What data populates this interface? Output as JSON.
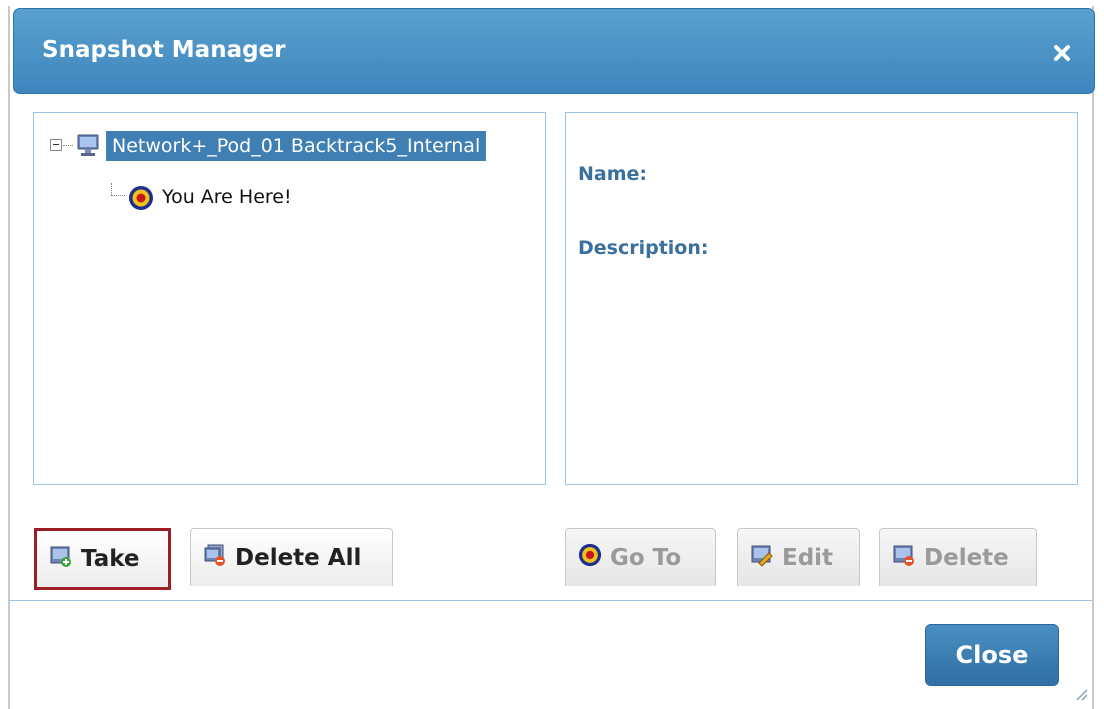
{
  "dialog": {
    "title": "Snapshot Manager",
    "close_icon": "close-x-icon"
  },
  "tree": {
    "root_label": "Network+_Pod_01 Backtrack5_Internal",
    "root_icon": "computer-icon",
    "child_label": "You Are Here!",
    "child_icon": "target-icon"
  },
  "details": {
    "name_label": "Name:",
    "description_label": "Description:"
  },
  "buttons": {
    "take": "Take",
    "delete_all": "Delete All",
    "go_to": "Go To",
    "edit": "Edit",
    "delete": "Delete",
    "close": "Close"
  },
  "colors": {
    "title_bar": "#3e86bd",
    "selection": "#3f7fb3",
    "highlight_border": "#9b1f24",
    "label_text": "#3a6f9e"
  }
}
